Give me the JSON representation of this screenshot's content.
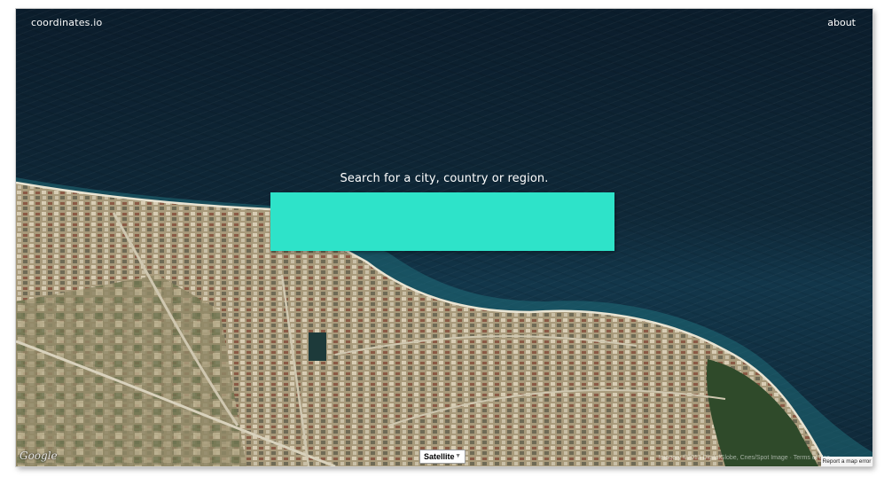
{
  "header": {
    "brand": "coordinates.io",
    "about_link": "about"
  },
  "search": {
    "prompt": "Search for a city, country or region.",
    "value": "",
    "placeholder": ""
  },
  "map": {
    "provider_logo": "Google",
    "map_type": "Satellite",
    "attribution": "Imagery ©2013 DigitalGlobe, Cnes/Spot Image · Terms of Use",
    "report_link": "Report a map error"
  },
  "colors": {
    "search_box": "#2ee3c9",
    "sea": "#0f2838",
    "land": "#b8ab8a"
  },
  "icons": {
    "map_type_caret": "chevron-down-icon"
  }
}
